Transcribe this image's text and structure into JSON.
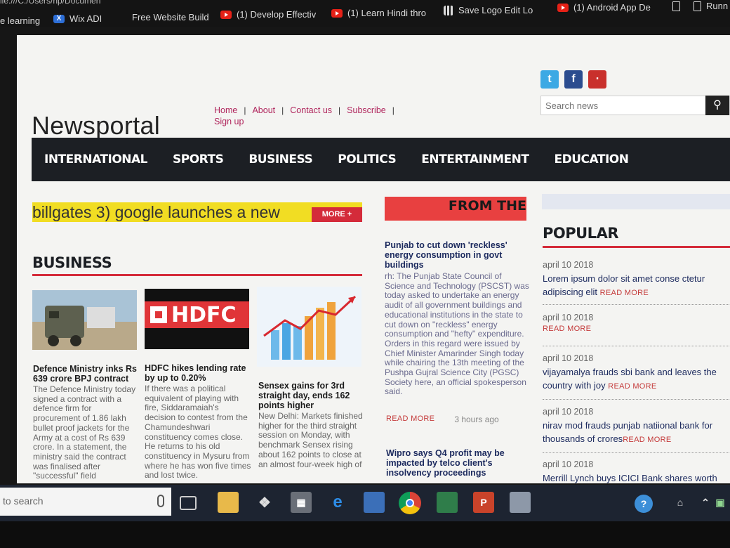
{
  "browser": {
    "url_fragment": "ile:///C:/Users/hp/Documen",
    "bookmarks": [
      {
        "label": "e learning",
        "icon": "none"
      },
      {
        "label": "Wix ADI",
        "icon": "wix-icon"
      },
      {
        "label": "Free Website Build",
        "icon": "none"
      },
      {
        "label": "(1) Develop Effectiv",
        "icon": "youtube-icon"
      },
      {
        "label": "(1) Learn Hindi thro",
        "icon": "youtube-icon"
      },
      {
        "label": "Save Logo Edit Lo",
        "icon": "grid-icon"
      },
      {
        "label": "(1) Android App De",
        "icon": "youtube-icon"
      },
      {
        "label": "",
        "icon": "document-icon"
      },
      {
        "label": "Runn",
        "icon": "document-icon"
      }
    ]
  },
  "site": {
    "logo": "Newsportal",
    "top_links": [
      "Home",
      "About",
      "Contact us",
      "Subscribe",
      "Sign up"
    ],
    "search_placeholder": "Search news",
    "social_icons": [
      "twitter-icon",
      "facebook-icon",
      "rss-icon"
    ],
    "nav": [
      "INTERNATIONAL",
      "SPORTS",
      "BUSINESS",
      "POLITICS",
      "ENTERTAINMENT",
      "EDUCATION"
    ],
    "ticker_text": "billgates 3) google launches a new",
    "more_button": "MORE +",
    "from_banner": "FROM THE",
    "accent_color": "#d42b3a"
  },
  "business": {
    "heading": "BUSINESS",
    "cards": [
      {
        "title": "Defence Ministry inks Rs 639 crore BPJ contract",
        "body": "The Defence Ministry today signed a contract with a defence firm for procurement of 1.86 lakh bullet proof jackets for the Army at a cost of Rs 639 crore. In a statement, the ministry said the contract was finalised after \"successful\" field"
      },
      {
        "title": "HDFC hikes lending rate by up to 0.20%",
        "body": "If there was a political equivalent of playing with fire, Siddaramaiah's decision to contest from the Chamundeshwari constituency comes close. He returns to his old constituency in Mysuru from where he has won five times and lost twice.",
        "thumb_text": "HDFC"
      },
      {
        "title": "Sensex gains for 3rd straight day, ends 162 points higher",
        "body": "New Delhi: Markets finished higher for the third straight session on Monday, with benchmark Sensex rising about 162 points to close at an almost four-week high of"
      }
    ]
  },
  "middle": {
    "title": "Punjab to cut down 'reckless' energy consumption in govt buildings",
    "body": "rh: The Punjab State Council of Science and Technology (PSCST) was today asked to undertake an energy audit of all government buildings and educational institutions in the state to cut down on \"reckless\" energy consumption and \"hefty\" expenditure. Orders in this regard were issued by Chief Minister Amarinder Singh today while chairing the 13th meeting of the Pushpa Gujral Science City (PGSC) Society here, an official spokesperson said.",
    "read_more": "READ MORE",
    "time": "3 hours ago",
    "title2": "Wipro says Q4 profit may be impacted by telco client's insolvency proceedings"
  },
  "popular": {
    "heading": "POPULAR",
    "read_more": "READ MORE",
    "items": [
      {
        "date": "april 10 2018",
        "text": "Lorem ipsum dolor sit amet conse ctetur adipiscing elit"
      },
      {
        "date": "april 10 2018",
        "text": ""
      },
      {
        "date": "april 10 2018",
        "text": "vijayamalya frauds sbi bank and leaves the country with joy"
      },
      {
        "date": "april 10 2018",
        "text": "nirav mod frauds punjab natiional bank for thousands of crores"
      },
      {
        "date": "april 10 2018",
        "text": "Merrill Lynch buys ICICI Bank shares worth"
      }
    ]
  },
  "taskbar": {
    "search_placeholder": "to search",
    "apps": [
      "task-view-icon",
      "file-explorer-icon",
      "dropbox-icon",
      "store-icon",
      "edge-icon",
      "photo-app-icon",
      "chrome-icon",
      "spreadsheet-icon",
      "powerpoint-icon",
      "photos-icon"
    ],
    "tray": [
      "help-icon",
      "people-icon",
      "chevron-up-icon",
      "network-icon"
    ]
  }
}
